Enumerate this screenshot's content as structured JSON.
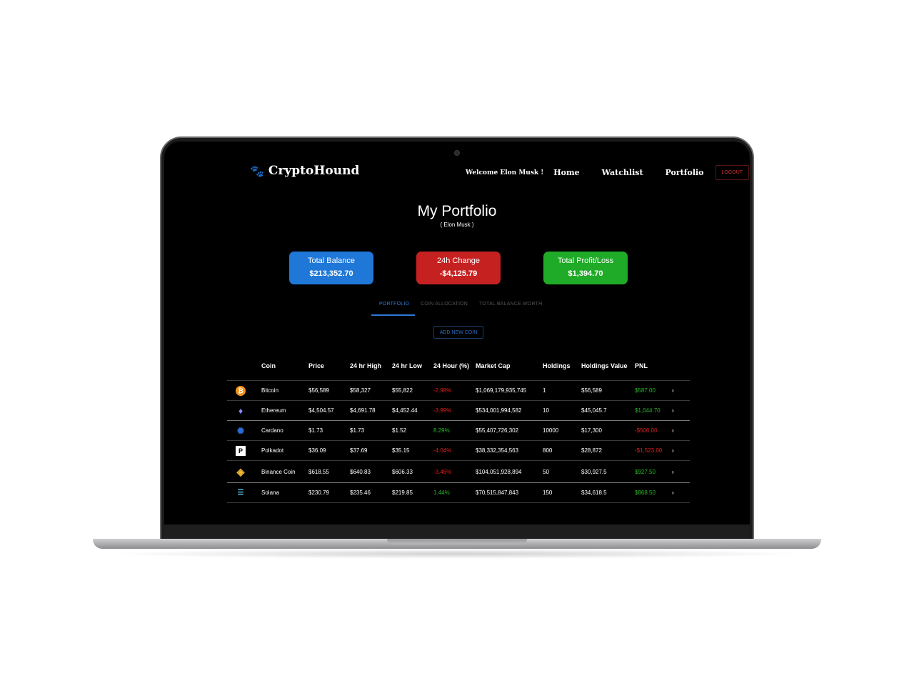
{
  "brand": {
    "name": "CryptoHound"
  },
  "nav": {
    "welcome": "Welcome Elon Musk !",
    "links": [
      "Home",
      "Watchlist",
      "Portfolio"
    ],
    "logout": "LOGOUT"
  },
  "page": {
    "title": "My Portfolio",
    "subtitle": "( Elon Musk )"
  },
  "cards": [
    {
      "label": "Total Balance",
      "value": "$213,352.70",
      "color": "#1f78d8"
    },
    {
      "label": "24h Change",
      "value": "-$4,125.79",
      "color": "#c62121"
    },
    {
      "label": "Total Profit/Loss",
      "value": "$1,394.70",
      "color": "#1faa28"
    }
  ],
  "tabs": [
    "PORTFOLIO",
    "COIN ALLOCATION",
    "TOTAL BALANCE WORTH"
  ],
  "add_button": "ADD NEW COIN",
  "table": {
    "headers": [
      "Coin",
      "Price",
      "24 hr High",
      "24 hr Low",
      "24 Hour (%)",
      "Market Cap",
      "Holdings",
      "Holdings Value",
      "PNL"
    ],
    "rows": [
      {
        "icon": "bitcoin-icon",
        "name": "Bitcoin",
        "price": "$56,589",
        "high": "$58,327",
        "low": "$55,822",
        "change": "-2.98%",
        "cap": "$1,069,179,935,745",
        "holdings": "1",
        "value": "$56,589",
        "pnl": "$587.00"
      },
      {
        "icon": "ethereum-icon",
        "name": "Ethereum",
        "price": "$4,504.57",
        "high": "$4,691.78",
        "low": "$4,452.44",
        "change": "-3.99%",
        "cap": "$534,001,994,582",
        "holdings": "10",
        "value": "$45,045.7",
        "pnl": "$1,044.70"
      },
      {
        "icon": "cardano-icon",
        "name": "Cardano",
        "price": "$1.73",
        "high": "$1.73",
        "low": "$1.52",
        "change": "8.29%",
        "cap": "$55,407,726,302",
        "holdings": "10000",
        "value": "$17,300",
        "pnl": "-$500.00"
      },
      {
        "icon": "polkadot-icon",
        "name": "Polkadot",
        "price": "$36.09",
        "high": "$37.69",
        "low": "$35.15",
        "change": "-4.04%",
        "cap": "$38,332,354,563",
        "holdings": "800",
        "value": "$28,872",
        "pnl": "-$1,523.00"
      },
      {
        "icon": "binance-coin-icon",
        "name": "Binance Coin",
        "price": "$618.55",
        "high": "$640.83",
        "low": "$606.33",
        "change": "-3.46%",
        "cap": "$104,051,928,894",
        "holdings": "50",
        "value": "$30,927.5",
        "pnl": "$927.50"
      },
      {
        "icon": "solana-icon",
        "name": "Solana",
        "price": "$230.79",
        "high": "$235.46",
        "low": "$219.85",
        "change": "1.44%",
        "cap": "$70,515,847,843",
        "holdings": "150",
        "value": "$34,618.5",
        "pnl": "$868.50"
      }
    ]
  }
}
